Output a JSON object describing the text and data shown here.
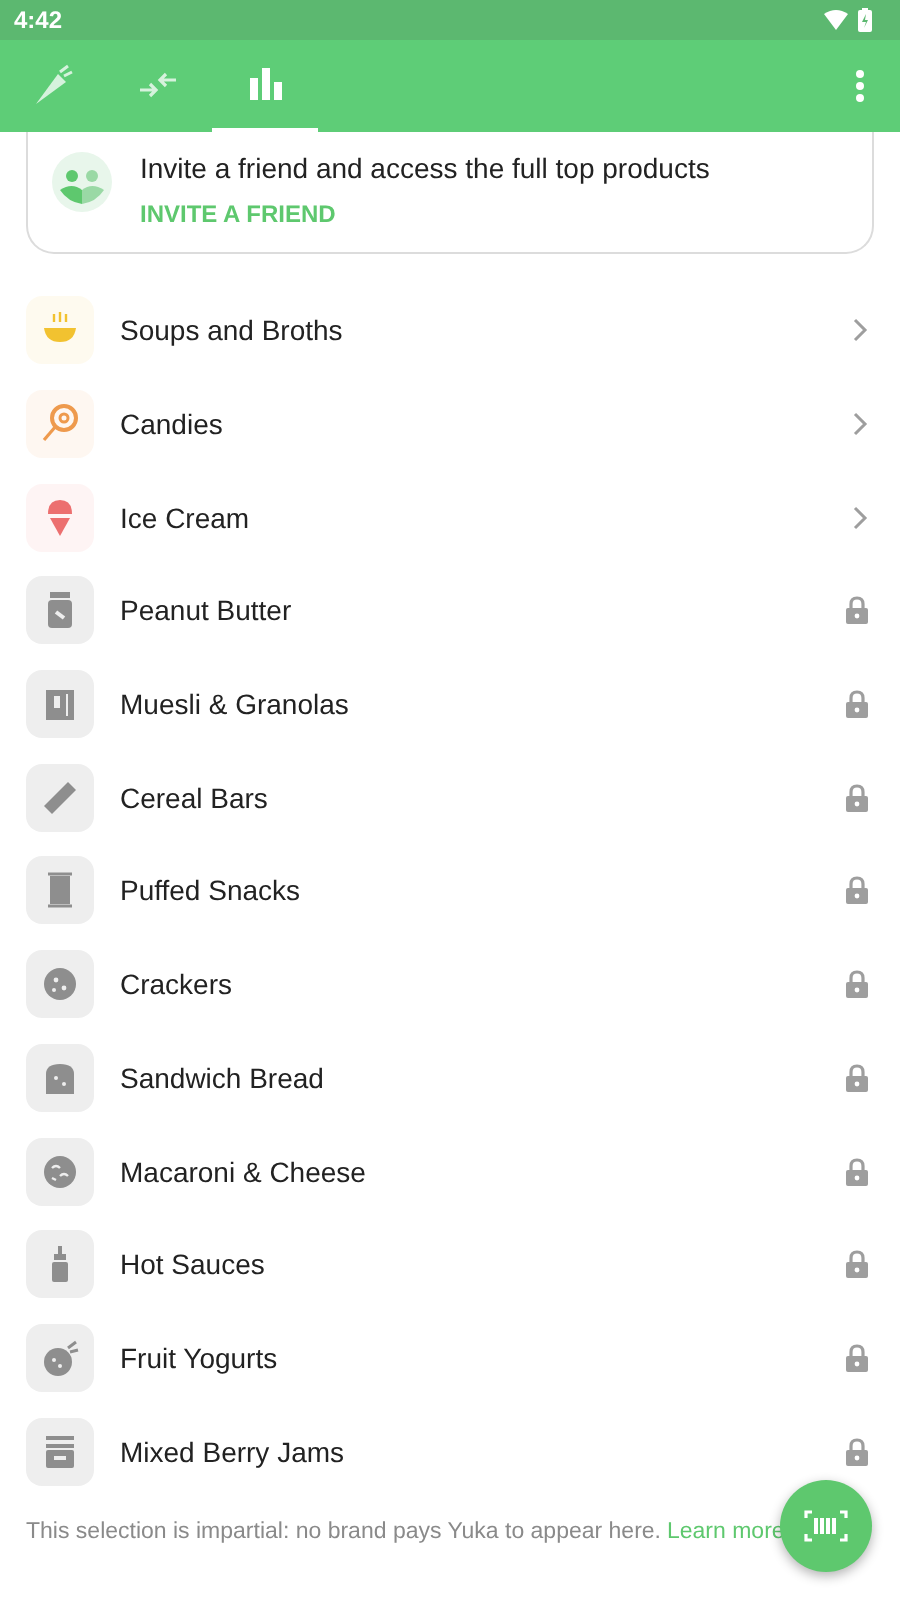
{
  "status_bar": {
    "time": "4:42"
  },
  "tabs": [
    {
      "kind": "carrot",
      "selected": false
    },
    {
      "kind": "compare",
      "selected": false
    },
    {
      "kind": "chart",
      "selected": true
    }
  ],
  "invite": {
    "text": "Invite a friend and access the full top products",
    "action": "INVITE A FRIEND"
  },
  "categories": [
    {
      "name": "Soups and Broths",
      "kind": "open",
      "color": "#f2c230"
    },
    {
      "name": "Candies",
      "kind": "open",
      "color": "#ee9a4d"
    },
    {
      "name": "Ice Cream",
      "kind": "open",
      "color": "#ec6f6f"
    },
    {
      "name": "Peanut Butter",
      "kind": "locked"
    },
    {
      "name": "Muesli & Granolas",
      "kind": "locked"
    },
    {
      "name": "Cereal Bars",
      "kind": "locked"
    },
    {
      "name": "Puffed Snacks",
      "kind": "locked"
    },
    {
      "name": "Crackers",
      "kind": "locked"
    },
    {
      "name": "Sandwich Bread",
      "kind": "locked"
    },
    {
      "name": "Macaroni & Cheese",
      "kind": "locked"
    },
    {
      "name": "Hot Sauces",
      "kind": "locked"
    },
    {
      "name": "Fruit Yogurts",
      "kind": "locked"
    },
    {
      "name": "Mixed Berry Jams",
      "kind": "locked"
    }
  ],
  "footer": {
    "text": "This selection is impartial: no brand pays Yuka to appear here.",
    "link": "Learn more"
  }
}
